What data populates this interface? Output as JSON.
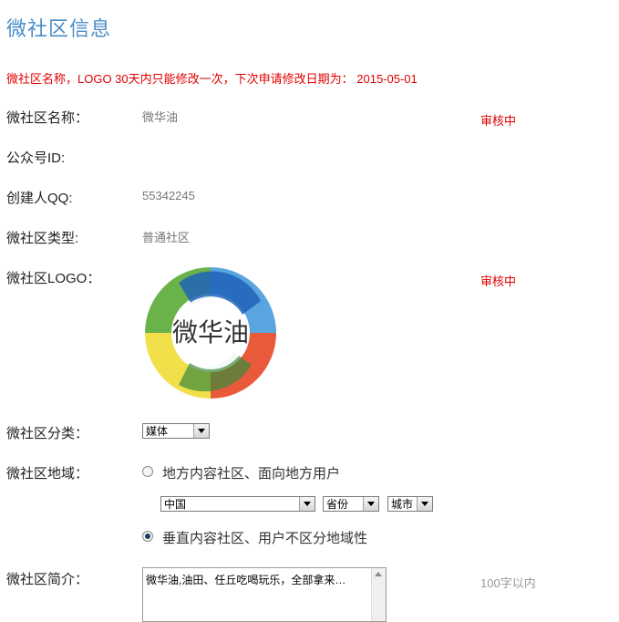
{
  "page_title": "微社区信息",
  "notice": "微社区名称，LOGO 30天内只能修改一次，下次申请修改日期为： 2015-05-01",
  "fields": {
    "name": {
      "label": "微社区名称：",
      "value": "微华油",
      "status": "审核中"
    },
    "mp_id": {
      "label": "公众号ID:"
    },
    "creator_qq": {
      "label": "创建人QQ:",
      "value": "55342245"
    },
    "type": {
      "label": "微社区类型:",
      "value": "普通社区"
    },
    "logo": {
      "label": "微社区LOGO：",
      "status": "审核中",
      "logo_text": "微华油"
    },
    "category": {
      "label": "微社区分类：",
      "selected": "媒体"
    },
    "region": {
      "label": "微社区地域：",
      "option_local": "地方内容社区、面向地方用户",
      "country": "中国",
      "province": "省份",
      "city": "城市",
      "option_vertical": "垂直内容社区、用户不区分地域性",
      "selected": "vertical"
    },
    "intro": {
      "label": "微社区简介：",
      "value": "微华油,油田、任丘吃喝玩乐，全部拿来…",
      "hint": "100字以内"
    }
  },
  "colors": {
    "title": "#4a8ec8",
    "alert": "#e00000"
  }
}
